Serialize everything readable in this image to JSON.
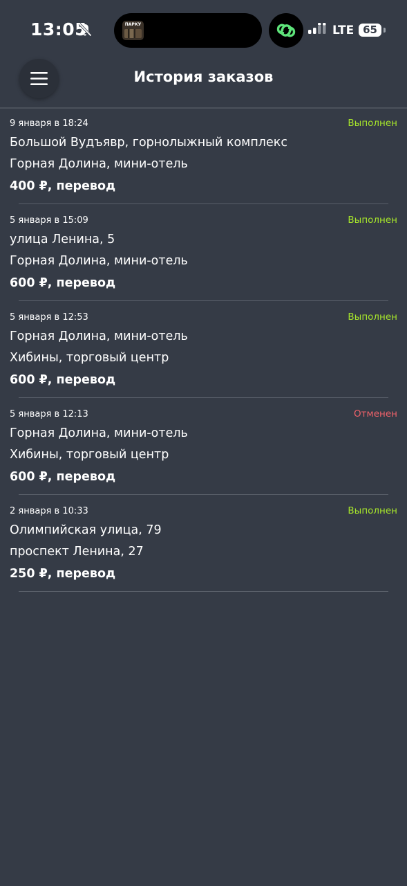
{
  "status_bar": {
    "time": "13:05",
    "network": "LTE",
    "battery": "65",
    "now_playing_art_label": "ПАРКУ"
  },
  "header": {
    "title": "История заказов"
  },
  "colors": {
    "background": "#353b46",
    "status_done": "#a6e52b",
    "status_cancelled": "#f0626a",
    "divider": "#5a606a"
  },
  "orders": [
    {
      "date": "9 января в 18:24",
      "status": "Выполнен",
      "status_kind": "done",
      "from": "Большой Вудъявр, горнолыжный комплекс",
      "to": "Горная Долина, мини-отель",
      "price": "400 ₽, перевод"
    },
    {
      "date": "5 января в 15:09",
      "status": "Выполнен",
      "status_kind": "done",
      "from": "улица Ленина, 5",
      "to": "Горная Долина, мини-отель",
      "price": "600 ₽, перевод"
    },
    {
      "date": "5 января в 12:53",
      "status": "Выполнен",
      "status_kind": "done",
      "from": "Горная Долина, мини-отель",
      "to": "Хибины, торговый центр",
      "price": "600 ₽, перевод"
    },
    {
      "date": "5 января в 12:13",
      "status": "Отменен",
      "status_kind": "cancelled",
      "from": "Горная Долина, мини-отель",
      "to": "Хибины, торговый центр",
      "price": "600 ₽, перевод"
    },
    {
      "date": "2 января в 10:33",
      "status": "Выполнен",
      "status_kind": "done",
      "from": "Олимпийская улица, 79",
      "to": "проспект Ленина, 27",
      "price": "250 ₽, перевод"
    }
  ]
}
